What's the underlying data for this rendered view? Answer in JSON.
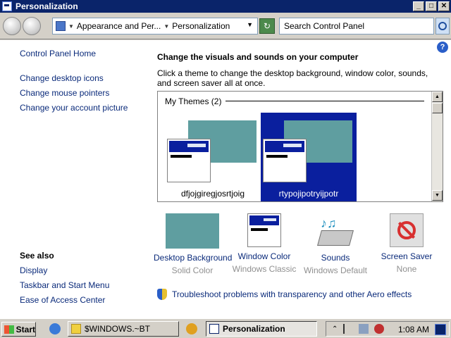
{
  "window": {
    "title": "Personalization"
  },
  "window_buttons": {
    "minimize": "_",
    "maximize": "□",
    "close": "✕"
  },
  "address": {
    "crumbs": [
      "Appearance and Per...",
      "Personalization"
    ],
    "search_placeholder": "Search Control Panel"
  },
  "sidebar": {
    "links": [
      "Control Panel Home",
      "Change desktop icons",
      "Change mouse pointers",
      "Change your account picture"
    ],
    "see_also_title": "See also",
    "see_also_links": [
      "Display",
      "Taskbar and Start Menu",
      "Ease of Access Center"
    ]
  },
  "main": {
    "heading": "Change the visuals and sounds on your computer",
    "description": "Click a theme to change the desktop background, window color, sounds, and screen saver all at once.",
    "group_label": "My Themes (2)",
    "themes": [
      {
        "name": "dfjojgiregjosrtjoig",
        "selected": false
      },
      {
        "name": "rtypojipotryijpotr",
        "selected": true
      }
    ],
    "options": [
      {
        "label": "Desktop Background",
        "value": "Solid Color"
      },
      {
        "label": "Window Color",
        "value": "Windows Classic"
      },
      {
        "label": "Sounds",
        "value": "Windows Default"
      },
      {
        "label": "Screen Saver",
        "value": "None"
      }
    ],
    "troubleshoot_link": "Troubleshoot problems with transparency and other Aero effects"
  },
  "taskbar": {
    "start_label": "Start",
    "tasks": [
      {
        "label": "$WINDOWS.~BT",
        "active": false
      },
      {
        "label": "Personalization",
        "active": true
      }
    ],
    "clock": "1:08 AM"
  },
  "colors": {
    "title_bar": "#0a246a",
    "selection": "#0a1f9e",
    "teal": "#5f9ea0",
    "link": "#0a2a7a"
  }
}
